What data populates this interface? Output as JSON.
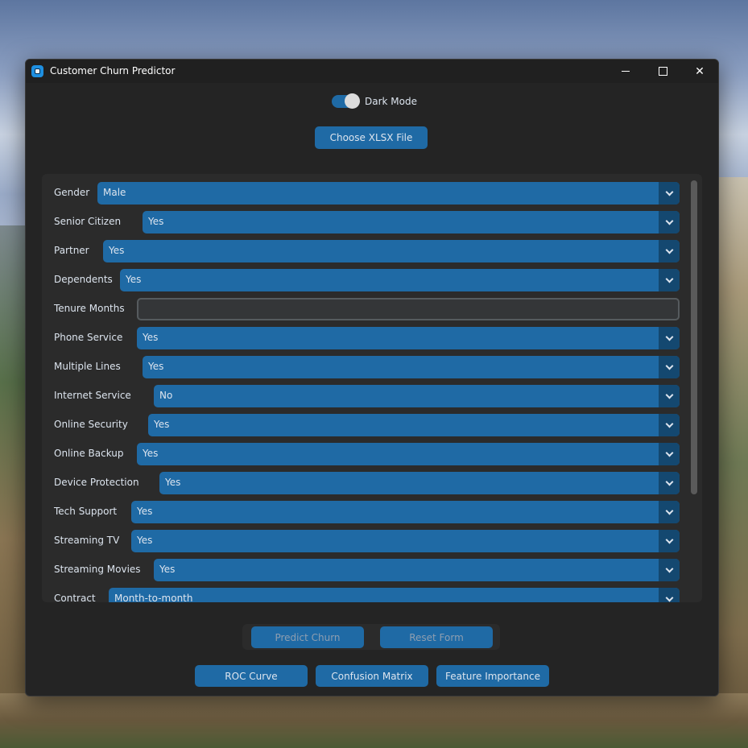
{
  "window": {
    "title": "Customer Churn Predictor",
    "controls": [
      "minimize-icon",
      "maximize-icon",
      "close-icon"
    ]
  },
  "theme": {
    "accent": "#1f6aa5",
    "dropdown_button": "#144870",
    "background": "#242424"
  },
  "dark_mode": {
    "label": "Dark Mode",
    "enabled": true
  },
  "file_button": {
    "label": "Choose XLSX File"
  },
  "form": {
    "fields": [
      {
        "label": "Gender",
        "type": "dropdown",
        "value": "Male"
      },
      {
        "label": "Senior Citizen",
        "type": "dropdown",
        "value": "Yes"
      },
      {
        "label": "Partner",
        "type": "dropdown",
        "value": "Yes"
      },
      {
        "label": "Dependents",
        "type": "dropdown",
        "value": "Yes"
      },
      {
        "label": "Tenure Months",
        "type": "entry",
        "value": ""
      },
      {
        "label": "Phone Service",
        "type": "dropdown",
        "value": "Yes"
      },
      {
        "label": "Multiple Lines",
        "type": "dropdown",
        "value": "Yes"
      },
      {
        "label": "Internet Service",
        "type": "dropdown",
        "value": "No"
      },
      {
        "label": "Online Security",
        "type": "dropdown",
        "value": "Yes"
      },
      {
        "label": "Online Backup",
        "type": "dropdown",
        "value": "Yes"
      },
      {
        "label": "Device Protection",
        "type": "dropdown",
        "value": "Yes"
      },
      {
        "label": "Tech Support",
        "type": "dropdown",
        "value": "Yes"
      },
      {
        "label": "Streaming TV",
        "type": "dropdown",
        "value": "Yes"
      },
      {
        "label": "Streaming Movies",
        "type": "dropdown",
        "value": "Yes"
      },
      {
        "label": "Contract",
        "type": "dropdown",
        "value": "Month-to-month"
      }
    ]
  },
  "actions": {
    "predict_label": "Predict Churn",
    "reset_label": "Reset Form"
  },
  "plots": {
    "roc_label": "ROC Curve",
    "confusion_label": "Confusion Matrix",
    "importance_label": "Feature Importance"
  }
}
